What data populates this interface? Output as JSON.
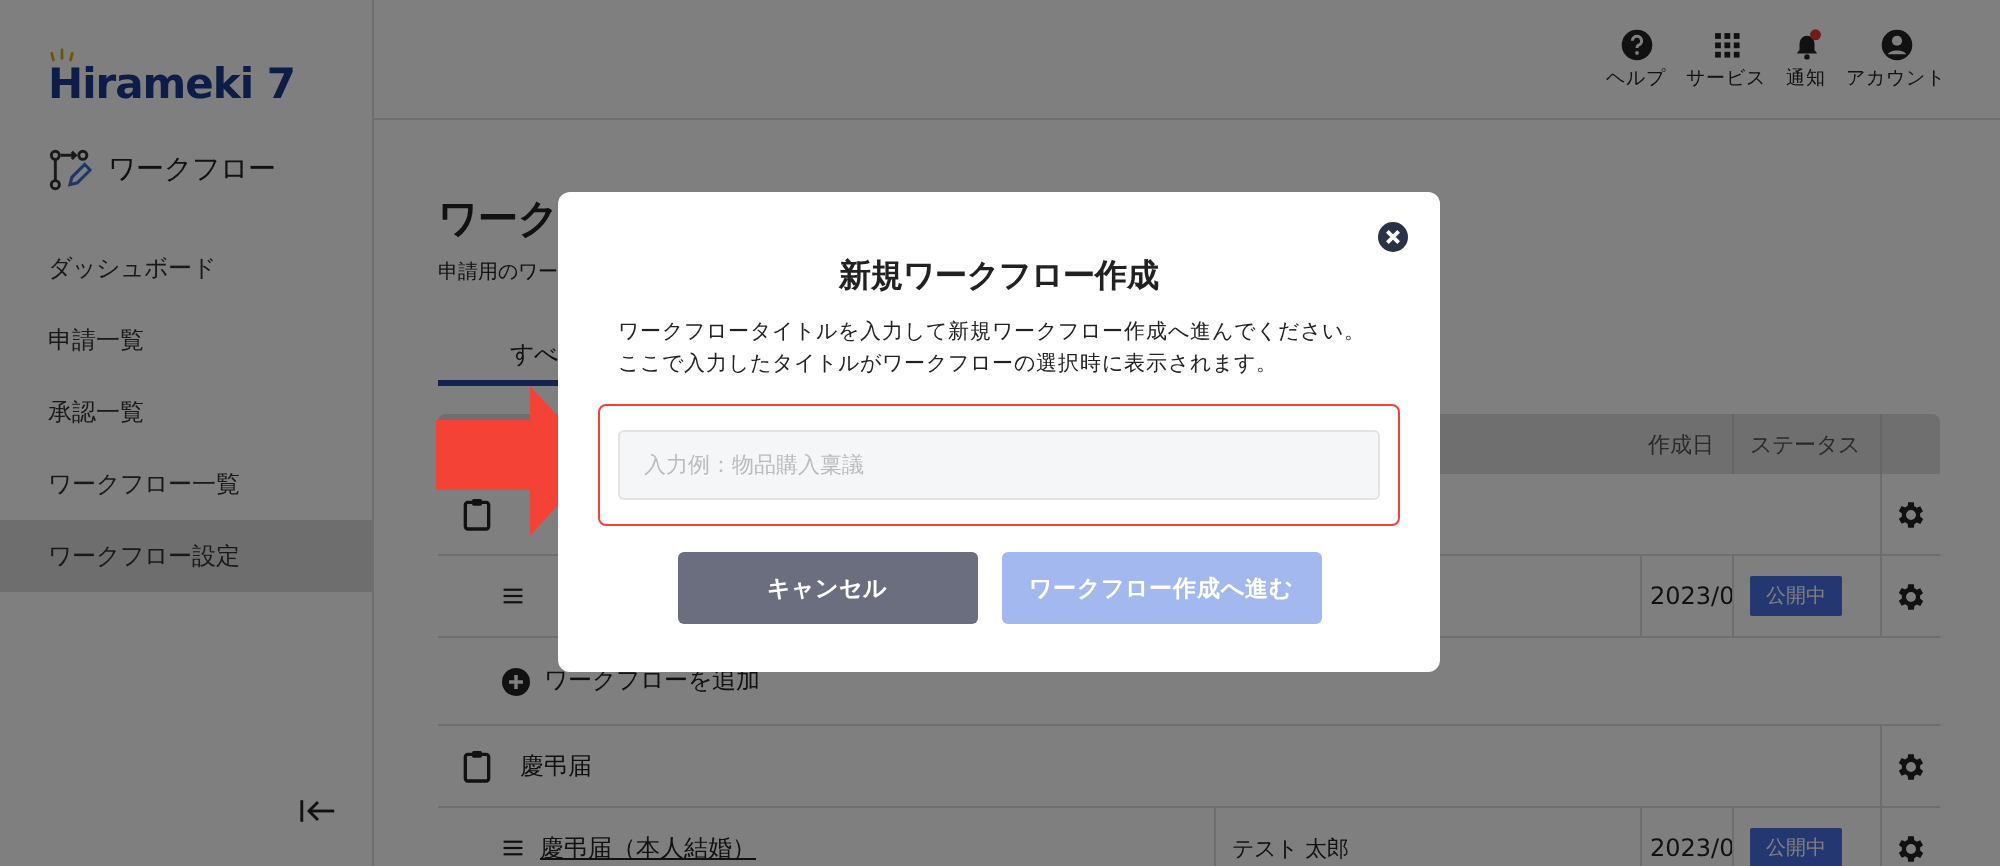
{
  "logo": {
    "text": "Hirameki 7"
  },
  "app": {
    "title": "ワークフロー"
  },
  "sidebar": {
    "items": [
      {
        "label": "ダッシュボード",
        "selected": false
      },
      {
        "label": "申請一覧",
        "selected": false
      },
      {
        "label": "承認一覧",
        "selected": false
      },
      {
        "label": "ワークフロー一覧",
        "selected": false
      },
      {
        "label": "ワークフロー設定",
        "selected": true
      }
    ]
  },
  "header": {
    "actions": [
      {
        "label": "ヘルプ",
        "kind": "help",
        "badge": false
      },
      {
        "label": "サービス",
        "kind": "grid",
        "badge": false
      },
      {
        "label": "通知",
        "kind": "bell",
        "badge": true
      },
      {
        "label": "アカウント",
        "kind": "account",
        "badge": false
      }
    ]
  },
  "page": {
    "title": "ワーク",
    "subtitle": "申請用のワー"
  },
  "tabs": [
    {
      "label": "すべ",
      "selected": true
    }
  ],
  "table": {
    "columns": [
      "作成日",
      "ステータス"
    ],
    "rows": [
      {
        "kind": "group"
      },
      {
        "kind": "item",
        "date": "2023/0",
        "status": "公開中"
      },
      {
        "kind": "add",
        "name": "ワークフローを追加"
      },
      {
        "kind": "group",
        "name": "慶弔届"
      },
      {
        "kind": "item",
        "name": "慶弔届（本人結婚）",
        "owner": "テスト 太郎",
        "date": "2023/0",
        "status": "公開中"
      }
    ]
  },
  "modal": {
    "title": "新規ワークフロー作成",
    "description": [
      "ワークフロータイトルを入力して新規ワークフロー作成へ進んでください。",
      "ここで入力したタイトルがワークフローの選択時に表示されます。"
    ],
    "input": {
      "placeholder": "入力例：物品購入稟議"
    },
    "buttons": [
      {
        "label": "キャンセル",
        "kind": "cancel",
        "disabled": false
      },
      {
        "label": "ワークフロー作成へ進む",
        "kind": "primary",
        "disabled": true
      }
    ]
  }
}
